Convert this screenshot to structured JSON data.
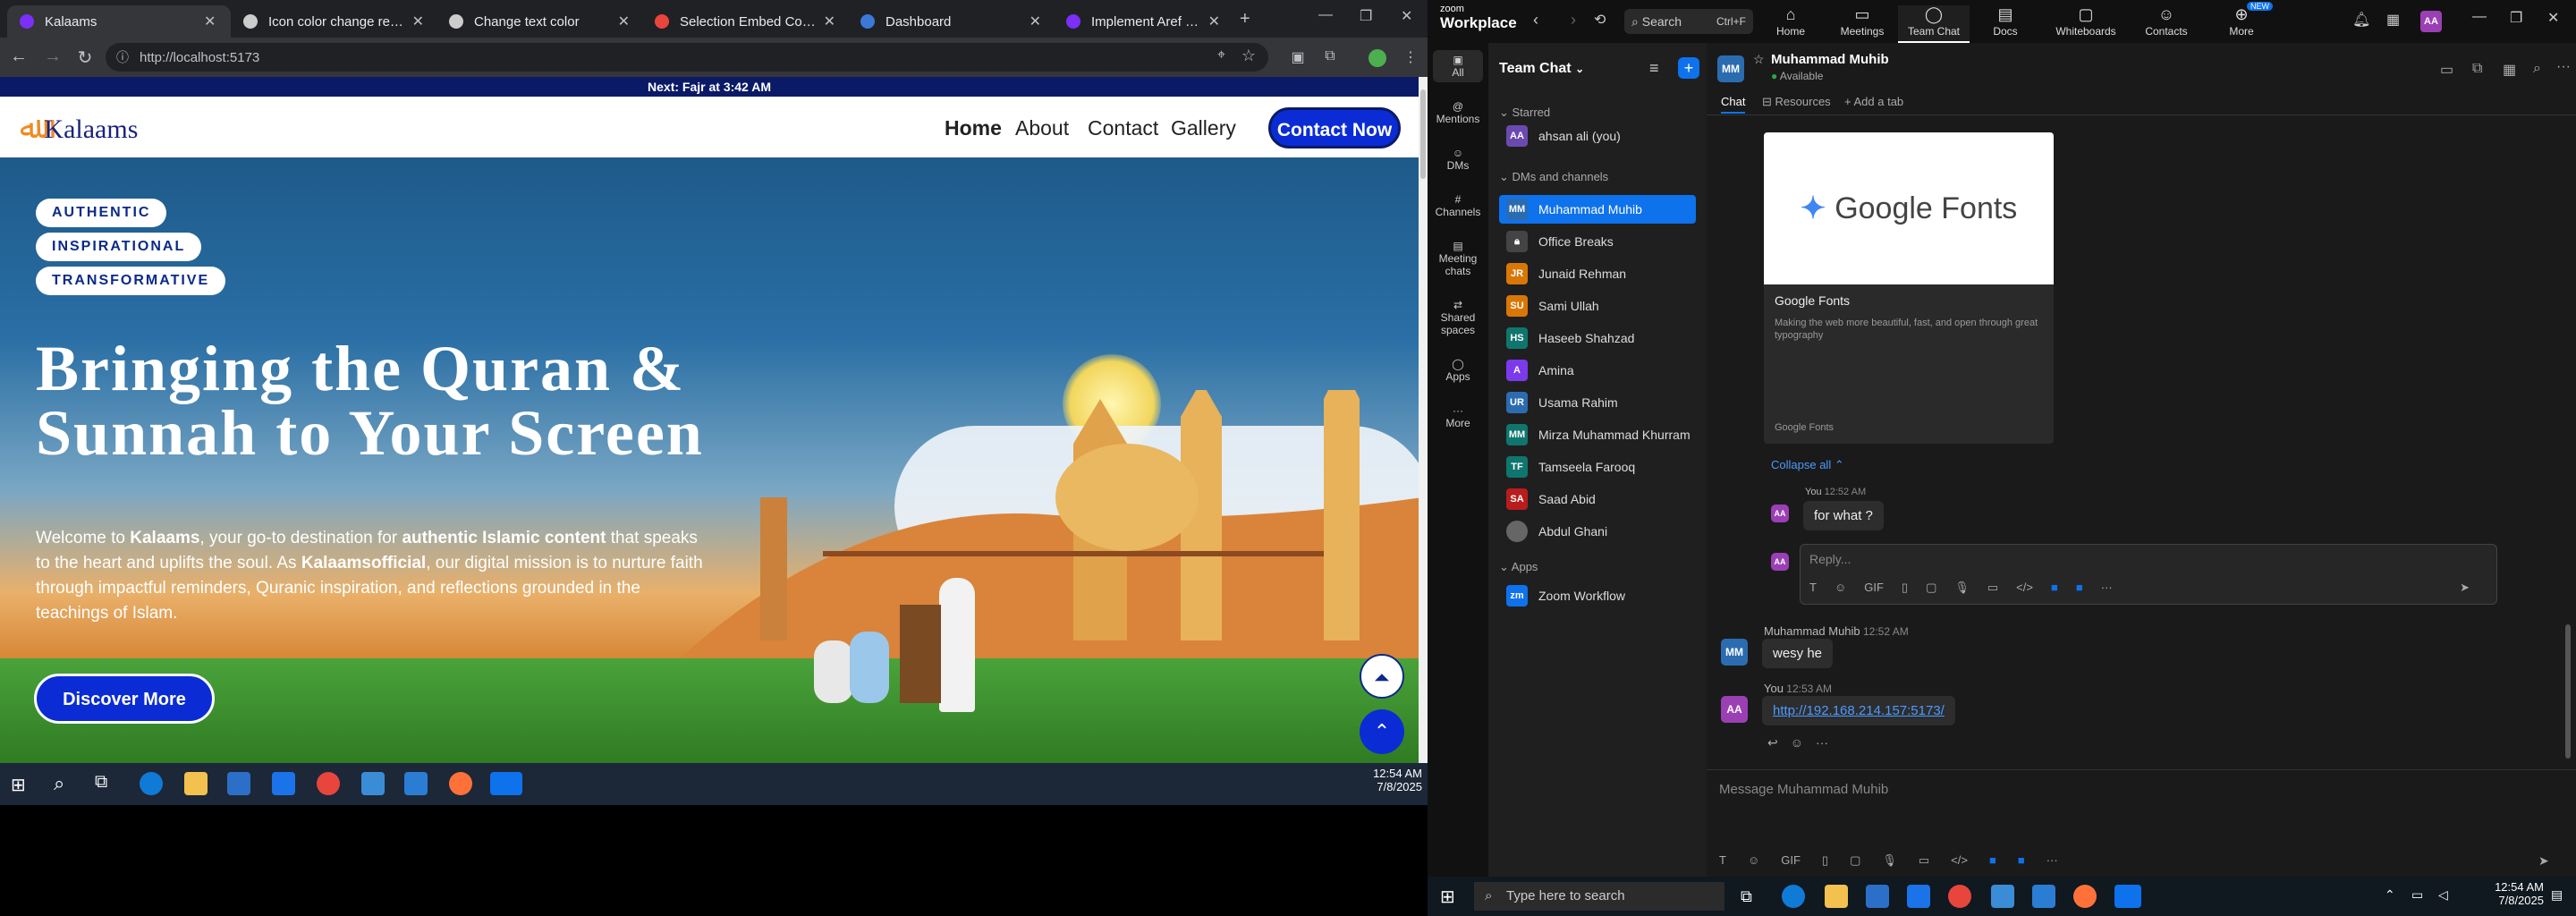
{
  "browser": {
    "tabs": [
      {
        "title": "Kalaams",
        "active": true,
        "favicon_color": "#7b2ff7"
      },
      {
        "title": "Icon color change request",
        "active": false,
        "favicon_color": "#cccccc"
      },
      {
        "title": "Change text color",
        "active": false,
        "favicon_color": "#cccccc"
      },
      {
        "title": "Selection Embed Code - Go",
        "active": false,
        "favicon_color": "#e8453c"
      },
      {
        "title": "Dashboard",
        "active": false,
        "favicon_color": "#3c78d8"
      },
      {
        "title": "Implement Aref Ruqaa Fonts",
        "active": false,
        "favicon_color": "#7b2ff7"
      }
    ],
    "url": "http://localhost:5173",
    "new_tab_label": "+"
  },
  "site": {
    "announcement": "Next: Fajr at 3:42 AM",
    "logo_text": "Kalaams",
    "nav": [
      "Home",
      "About",
      "Contact",
      "Gallery"
    ],
    "contact_label": "Contact Now",
    "pills": [
      "AUTHENTIC",
      "INSPIRATIONAL",
      "TRANSFORMATIVE"
    ],
    "headline_1": "Bringing the Quran &",
    "headline_2": "Sunnah to Your Screen",
    "desc": {
      "p1": "Welcome to ",
      "b1": "Kalaams",
      "p2": ", your go-to destination for ",
      "b2": "authentic Islamic content",
      "p3": " that speaks to the heart and uplifts the soul. As ",
      "b3": "Kalaamsofficial",
      "p4": ", our digital mission is to nurture faith through impactful reminders, Quranic inspiration, and reflections grounded in the teachings of Islam."
    },
    "discover_label": "Discover More"
  },
  "taskbar_left": {
    "time": "12:54 AM",
    "date": "7/8/2025"
  },
  "zoom": {
    "brand_top": "zoom",
    "brand": "Workplace",
    "search_label": "Search",
    "search_shortcut": "Ctrl+F",
    "apps": [
      "Home",
      "Meetings",
      "Team Chat",
      "Docs",
      "Whiteboards",
      "Contacts",
      "More"
    ],
    "new_badge": "NEW",
    "user_initials": "AA",
    "rail": [
      "All",
      "Mentions",
      "DMs",
      "Channels",
      "Meeting chats",
      "Shared spaces",
      "Apps",
      "More"
    ],
    "panel_title": "Team Chat",
    "section_starred": "Starred",
    "starred": [
      {
        "name": "ahsan ali (you)",
        "initials": "AA",
        "color": "#6b4ab0"
      }
    ],
    "section_dms": "DMs and channels",
    "dms": [
      {
        "name": "Muhammad Muhib",
        "initials": "MM",
        "color": "#2b6cb0",
        "selected": true
      },
      {
        "name": "Office Breaks",
        "initials": "",
        "color": "#444444",
        "selected": false
      },
      {
        "name": "Junaid Rehman",
        "initials": "JR",
        "color": "#d97706",
        "selected": false
      },
      {
        "name": "Sami Ullah",
        "initials": "SU",
        "color": "#d97706",
        "selected": false
      },
      {
        "name": "Haseeb Shahzad",
        "initials": "HS",
        "color": "#0f766e",
        "selected": false
      },
      {
        "name": "Amina",
        "initials": "A",
        "color": "#7c3aed",
        "selected": false
      },
      {
        "name": "Usama Rahim",
        "initials": "UR",
        "color": "#2b6cb0",
        "selected": false
      },
      {
        "name": "Mirza Muhammad Khurram",
        "initials": "MM",
        "color": "#0f766e",
        "selected": false
      },
      {
        "name": "Tamseela Farooq",
        "initials": "TF",
        "color": "#0f766e",
        "selected": false
      },
      {
        "name": "Saad Abid",
        "initials": "SA",
        "color": "#b91c1c",
        "selected": false
      },
      {
        "name": "Abdul Ghani",
        "initials": "",
        "color": "#666666",
        "selected": false
      }
    ],
    "section_apps": "Apps",
    "apps_list": [
      {
        "name": "Zoom Workflow",
        "color": "#0e72ed"
      }
    ],
    "chat": {
      "contact_name": "Muhammad Muhib",
      "contact_initials": "MM",
      "status": "Available",
      "tabs": [
        "Chat",
        "Resources",
        "Add a tab"
      ],
      "preview_title": "Google Fonts",
      "preview_desc": "Making the web more beautiful, fast, and open through great typography",
      "preview_source": "Google Fonts",
      "collapse_label": "Collapse all",
      "thread_reply_sender": "You",
      "thread_reply_time": "12:52 AM",
      "thread_reply_text": "for what ?",
      "reply_placeholder": "Reply...",
      "msg2_sender": "Muhammad Muhib",
      "msg2_time": "12:52 AM",
      "msg2_text": "wesy he",
      "msg3_sender": "You",
      "msg3_time": "12:53 AM",
      "msg3_link": "http://192.168.214.157:5173/",
      "composer_placeholder": "Message Muhammad Muhib",
      "gif_label": "GIF"
    }
  },
  "taskbar_right": {
    "search_placeholder": "Type here to search",
    "time": "12:54 AM",
    "date": "7/8/2025"
  }
}
